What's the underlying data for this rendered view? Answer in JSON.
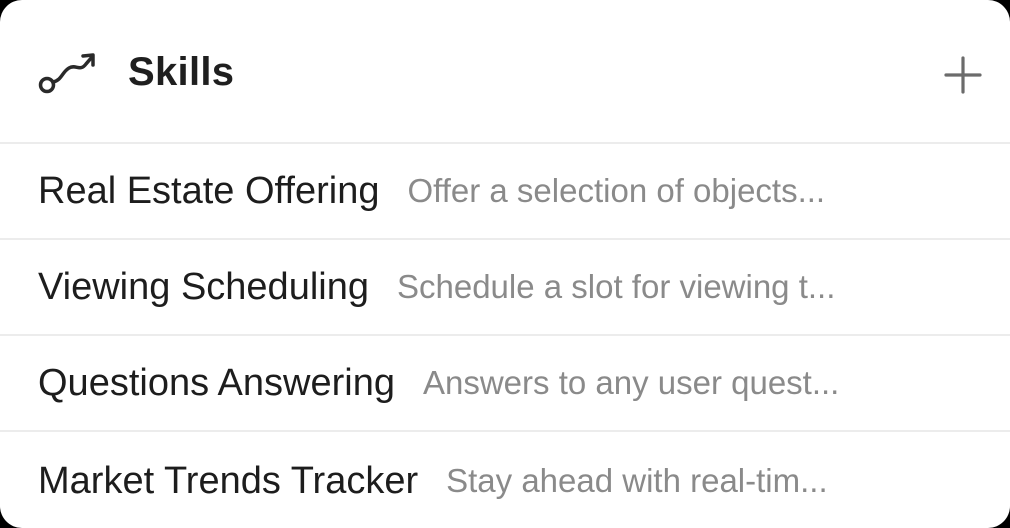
{
  "header": {
    "icon": "skill-path-icon",
    "title": "Skills",
    "add_icon": "plus-icon"
  },
  "skills": [
    {
      "title": "Real Estate Offering",
      "description": "Offer a selection of objects..."
    },
    {
      "title": "Viewing Scheduling",
      "description": "Schedule a slot for viewing t..."
    },
    {
      "title": "Questions Answering",
      "description": "Answers to any user quest..."
    },
    {
      "title": "Market Trends Tracker",
      "description": "Stay ahead with real-tim..."
    }
  ],
  "colors": {
    "background": "#ffffff",
    "title_text": "#1f1f1f",
    "description_text": "#8a8a8a",
    "divider": "#ececec",
    "icon": "#2a2a2a"
  }
}
